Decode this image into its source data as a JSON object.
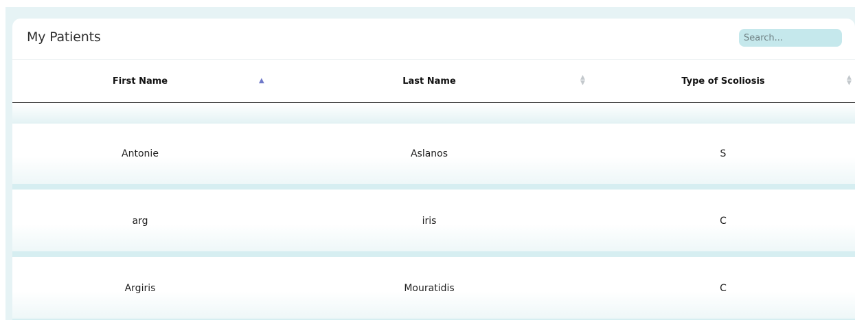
{
  "card": {
    "title": "My Patients",
    "search_placeholder": "Search..."
  },
  "table": {
    "columns": [
      {
        "label": "First Name",
        "sort": "ascending"
      },
      {
        "label": "Last Name",
        "sort": "none"
      },
      {
        "label": "Type of Scoliosis",
        "sort": "none"
      }
    ],
    "rows": [
      {
        "first_name": "Antonie",
        "last_name": "Aslanos",
        "type": "S"
      },
      {
        "first_name": "arg",
        "last_name": "iris",
        "type": "C"
      },
      {
        "first_name": "Argiris",
        "last_name": "Mouratidis",
        "type": "C"
      }
    ]
  },
  "colors": {
    "background": "#e6f3f5",
    "search_bg": "#c5e8ec",
    "sort_active": "#6f79c9",
    "sort_inactive": "#c3c8cc"
  }
}
